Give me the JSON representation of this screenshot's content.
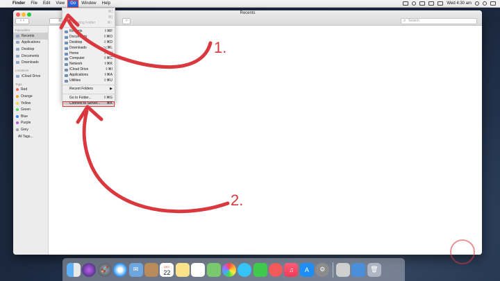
{
  "menubar": {
    "items": [
      "Finder",
      "File",
      "Edit",
      "View",
      "Go",
      "Window",
      "Help"
    ],
    "clock": "Wed 4:30 am"
  },
  "window": {
    "title": "Recents",
    "search_placeholder": "Search",
    "sidebar": {
      "favourites_header": "Favourites",
      "favourites": [
        "Recents",
        "Applications",
        "Desktop",
        "Documents",
        "Downloads"
      ],
      "locations_header": "Locations",
      "locations": [
        "iCloud Drive"
      ],
      "tags_header": "Tags",
      "tags": [
        {
          "label": "Red",
          "color": "#fc5f57"
        },
        {
          "label": "Orange",
          "color": "#f5a623"
        },
        {
          "label": "Yellow",
          "color": "#f8d84a"
        },
        {
          "label": "Green",
          "color": "#4cd964"
        },
        {
          "label": "Blue",
          "color": "#3b82f6"
        },
        {
          "label": "Purple",
          "color": "#b05fd6"
        },
        {
          "label": "Grey",
          "color": "#9b9b9b"
        },
        {
          "label": "All Tags..."
        }
      ]
    }
  },
  "go_menu": {
    "items_top": [
      {
        "label": "",
        "shortcut": "⌘[",
        "dim": true
      },
      {
        "label": "",
        "shortcut": "⌘]",
        "dim": true
      },
      {
        "label": "Enclosing Folder",
        "shortcut": "⌘↑",
        "dim": true
      }
    ],
    "places": [
      {
        "label": "Recents",
        "shortcut": "⇧⌘F"
      },
      {
        "label": "Documents",
        "shortcut": "⇧⌘O"
      },
      {
        "label": "Desktop",
        "shortcut": "⇧⌘D"
      },
      {
        "label": "Downloads",
        "shortcut": "⌥⌘L"
      },
      {
        "label": "Home",
        "shortcut": "⇧⌘H"
      },
      {
        "label": "Computer",
        "shortcut": "⇧⌘C"
      },
      {
        "label": "Network",
        "shortcut": "⇧⌘K"
      },
      {
        "label": "iCloud Drive",
        "shortcut": "⇧⌘I"
      },
      {
        "label": "Applications",
        "shortcut": "⇧⌘A"
      },
      {
        "label": "Utilities",
        "shortcut": "⇧⌘U"
      }
    ],
    "recent_folders": "Recent Folders",
    "go_to_folder": {
      "label": "Go to Folder...",
      "shortcut": "⇧⌘G"
    },
    "connect_to_server": {
      "label": "Connect to Server...",
      "shortcut": "⌘K"
    }
  },
  "annotations": {
    "step1": "1.",
    "step2": "2.",
    "accent": "#d9393e"
  },
  "dock": {
    "calendar_month": "DEC",
    "calendar_day": "22",
    "icons": [
      "finder-icon",
      "siri-icon",
      "launchpad-icon",
      "safari-icon",
      "mail-icon",
      "contacts-icon",
      "calendar-icon",
      "notes-icon",
      "reminders-icon",
      "maps-icon",
      "photos-icon",
      "messages-icon",
      "facetime-icon",
      "news-icon",
      "music-icon",
      "app-store-icon",
      "system-preferences-icon",
      "utility-icon",
      "downloads-icon",
      "trash-icon"
    ]
  }
}
